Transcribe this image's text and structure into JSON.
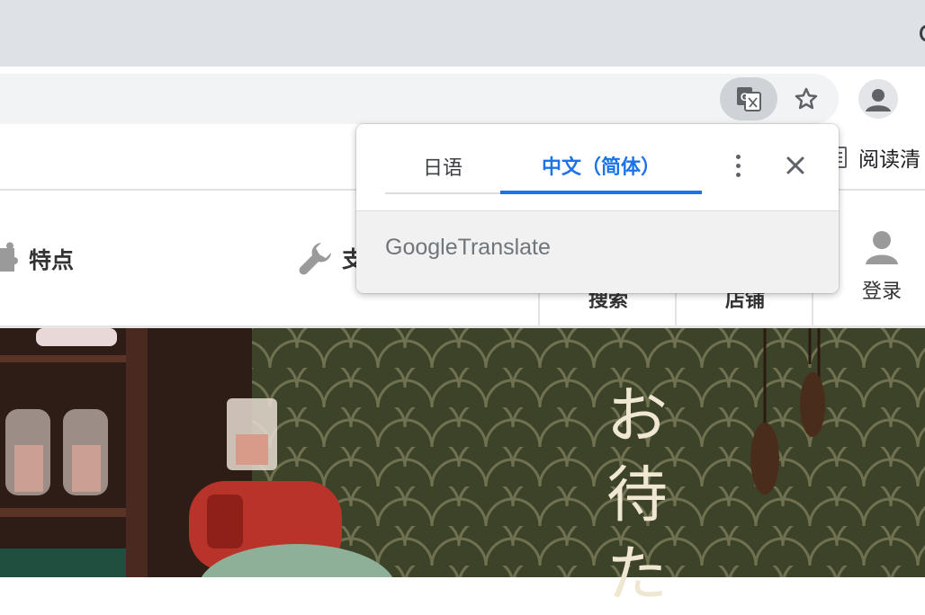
{
  "colors": {
    "accent": "#1a73e8",
    "tabstrip": "#dee1e6",
    "omnibox": "#f1f3f4",
    "hero_bg": "#3a3f28",
    "hero_text": "#efe7d2"
  },
  "toolbar": {
    "translate_icon": "google-translate-icon",
    "star_icon": "bookmark-star-icon",
    "profile_icon": "profile-icon"
  },
  "page": {
    "reader_mode_label": "阅读清",
    "nav": {
      "feature_label": "特点",
      "wrench_label": "支",
      "search_label": "搜索",
      "shops_label": "店铺",
      "login_label": "登录"
    },
    "hero_text": [
      "お",
      "待",
      "た"
    ]
  },
  "translate_popup": {
    "source_language": "日语",
    "target_language": "中文（简体）",
    "brand_google": "Google",
    "brand_translate": "Translate",
    "more_icon": "more-vert-icon",
    "close_icon": "close-icon"
  }
}
